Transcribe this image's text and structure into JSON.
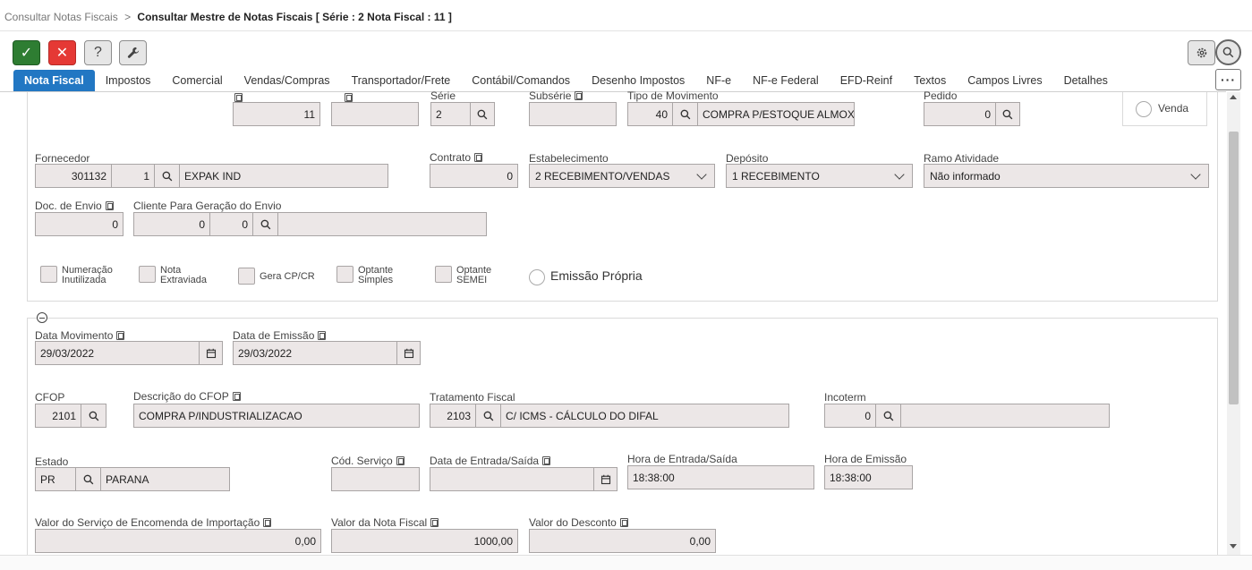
{
  "breadcrumb": {
    "parent": "Consultar Notas Fiscais",
    "separator": ">",
    "current": "Consultar Mestre de Notas Fiscais [ Série : 2 Nota Fiscal : 11 ]"
  },
  "toolbar": {
    "ok_icon": "✓",
    "cancel_icon": "✕",
    "help_icon": "?",
    "tools_icon": "wrench"
  },
  "tabs": [
    "Nota Fiscal",
    "Impostos",
    "Comercial",
    "Vendas/Compras",
    "Transportador/Frete",
    "Contábil/Comandos",
    "Desenho Impostos",
    "NF-e",
    "NF-e Federal",
    "EFD-Reinf",
    "Textos",
    "Campos Livres",
    "Detalhes"
  ],
  "more_label": "···",
  "top_row": {
    "field1_value": "11",
    "field2_value": "",
    "serie_label": "Série",
    "serie_value": "2",
    "subserie_label": "Subsérie",
    "subserie_value": "",
    "tipo_mov_label": "Tipo de Movimento",
    "tipo_mov_code": "40",
    "tipo_mov_desc": "COMPRA P/ESTOQUE ALMOX",
    "pedido_label": "Pedido",
    "pedido_value": "0",
    "radio_venda": "Venda"
  },
  "fornecedor": {
    "label": "Fornecedor",
    "code": "301132",
    "seq": "1",
    "name": "EXPAK IND"
  },
  "contrato": {
    "label": "Contrato",
    "value": "0"
  },
  "estabelecimento": {
    "label": "Estabelecimento",
    "value": "2 RECEBIMENTO/VENDAS"
  },
  "deposito": {
    "label": "Depósito",
    "value": "1 RECEBIMENTO"
  },
  "ramo": {
    "label": "Ramo Atividade",
    "value": "Não informado"
  },
  "doc_envio": {
    "label": "Doc. de Envio",
    "value": "0"
  },
  "cliente_envio": {
    "label": "Cliente Para Geração do Envio",
    "code": "0",
    "seq": "0",
    "name": ""
  },
  "checkboxes": [
    {
      "line1": "Numeração",
      "line2": "Inutilizada"
    },
    {
      "line1": "Nota",
      "line2": "Extraviada"
    },
    {
      "line1": "Gera CP/CR",
      "line2": ""
    },
    {
      "line1": "Optante",
      "line2": "Simples"
    },
    {
      "line1": "Optante",
      "line2": "SEMEI"
    }
  ],
  "emissao_propria": "Emissão Própria",
  "datas": {
    "data_mov_label": "Data Movimento",
    "data_mov_value": "29/03/2022",
    "data_emi_label": "Data de Emissão",
    "data_emi_value": "29/03/2022"
  },
  "cfop": {
    "label": "CFOP",
    "value": "2101",
    "desc_label": "Descrição do CFOP",
    "desc_value": "COMPRA P/INDUSTRIALIZACAO"
  },
  "tratamento": {
    "label": "Tratamento Fiscal",
    "code": "2103",
    "desc": "C/ ICMS - CÁLCULO DO DIFAL"
  },
  "incoterm": {
    "label": "Incoterm",
    "code": "0",
    "desc": ""
  },
  "estado": {
    "label": "Estado",
    "code": "PR",
    "name": "PARANA"
  },
  "cod_servico": {
    "label": "Cód. Serviço",
    "value": ""
  },
  "data_entrada": {
    "label": "Data de Entrada/Saída",
    "value": ""
  },
  "hora_entrada": {
    "label": "Hora de Entrada/Saída",
    "value": "18:38:00"
  },
  "hora_emissao": {
    "label": "Hora de Emissão",
    "value": "18:38:00"
  },
  "valores": {
    "servico_label": "Valor do Serviço de Encomenda de Importação",
    "servico_value": "0,00",
    "nota_label": "Valor da Nota Fiscal",
    "nota_value": "1000,00",
    "desconto_label": "Valor do Desconto",
    "desconto_value": "0,00"
  }
}
